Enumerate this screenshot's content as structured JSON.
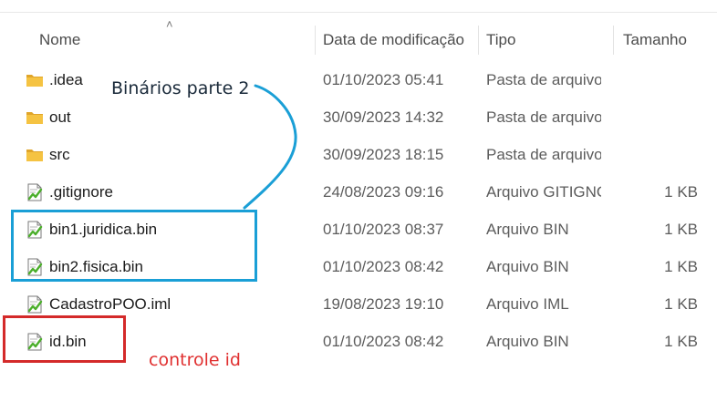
{
  "columns": {
    "name": "Nome",
    "date": "Data de modificação",
    "type": "Tipo",
    "size": "Tamanho"
  },
  "files": [
    {
      "name": ".idea",
      "date": "01/10/2023 05:41",
      "type": "Pasta de arquivos",
      "size": "",
      "icon": "folder-icon"
    },
    {
      "name": "out",
      "date": "30/09/2023 14:32",
      "type": "Pasta de arquivos",
      "size": "",
      "icon": "folder-icon"
    },
    {
      "name": "src",
      "date": "30/09/2023 18:15",
      "type": "Pasta de arquivos",
      "size": "",
      "icon": "folder-icon"
    },
    {
      "name": ".gitignore",
      "date": "24/08/2023 09:16",
      "type": "Arquivo GITIGNORE",
      "size": "1 KB",
      "icon": "text-file-icon"
    },
    {
      "name": "bin1.juridica.bin",
      "date": "01/10/2023 08:37",
      "type": "Arquivo BIN",
      "size": "1 KB",
      "icon": "text-file-icon"
    },
    {
      "name": "bin2.fisica.bin",
      "date": "01/10/2023 08:42",
      "type": "Arquivo BIN",
      "size": "1 KB",
      "icon": "text-file-icon"
    },
    {
      "name": "CadastroPOO.iml",
      "date": "19/08/2023 19:10",
      "type": "Arquivo IML",
      "size": "1 KB",
      "icon": "text-file-icon"
    },
    {
      "name": "id.bin",
      "date": "01/10/2023 08:42",
      "type": "Arquivo BIN",
      "size": "1 KB",
      "icon": "text-file-icon"
    }
  ],
  "annotations": {
    "binarios": {
      "text": "Binários parte 2",
      "color": "#1a9fd6"
    },
    "controle": {
      "text": "controle id",
      "color": "#e03030"
    }
  },
  "colors": {
    "folder": "#f5c342",
    "folder_dark": "#e0a52a",
    "file_check": "#4caf2c"
  }
}
